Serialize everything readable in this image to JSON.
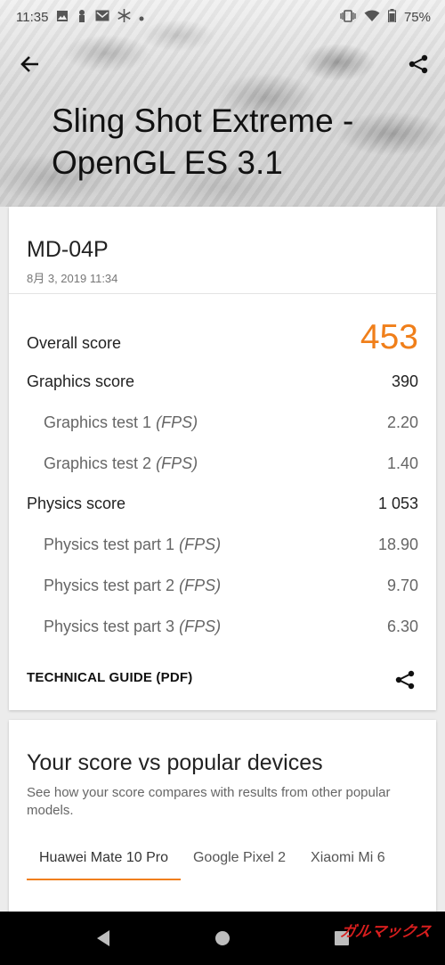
{
  "status_bar": {
    "time": "11:35",
    "battery": "75%",
    "icons": [
      "image-icon",
      "person-icon",
      "mail-icon",
      "snowflake-icon",
      "dot-icon",
      "vibrate-icon",
      "wifi-icon",
      "battery-icon"
    ]
  },
  "header": {
    "title": "Sling Shot Extreme - OpenGL ES 3.1",
    "back_icon": "back-arrow-icon",
    "share_icon": "share-icon"
  },
  "result": {
    "device_name": "MD-04P",
    "date": "8月 3, 2019 11:34",
    "overall_label": "Overall score",
    "overall_value": "453",
    "graphics_label": "Graphics score",
    "graphics_value": "390",
    "graphics_tests": [
      {
        "label": "Graphics test 1",
        "unit": "(FPS)",
        "value": "2.20"
      },
      {
        "label": "Graphics test 2",
        "unit": "(FPS)",
        "value": "1.40"
      }
    ],
    "physics_label": "Physics score",
    "physics_value": "1 053",
    "physics_tests": [
      {
        "label": "Physics test part 1",
        "unit": "(FPS)",
        "value": "18.90"
      },
      {
        "label": "Physics test part 2",
        "unit": "(FPS)",
        "value": "9.70"
      },
      {
        "label": "Physics test part 3",
        "unit": "(FPS)",
        "value": "6.30"
      }
    ],
    "technical_guide": "TECHNICAL GUIDE (PDF)"
  },
  "comparison": {
    "title": "Your score vs popular devices",
    "description": "See how your score compares with results from other popular models.",
    "tabs": [
      {
        "label": "Huawei Mate 10 Pro",
        "active": true
      },
      {
        "label": "Google Pixel 2",
        "active": false
      },
      {
        "label": "Xiaomi Mi 6",
        "active": false
      }
    ]
  },
  "nav_bar": {
    "icons": [
      "back-triangle-icon",
      "home-circle-icon",
      "recents-square-icon"
    ]
  },
  "watermark": "ガルマックス",
  "colors": {
    "accent": "#f07f1a",
    "watermark": "#d81e1e"
  }
}
